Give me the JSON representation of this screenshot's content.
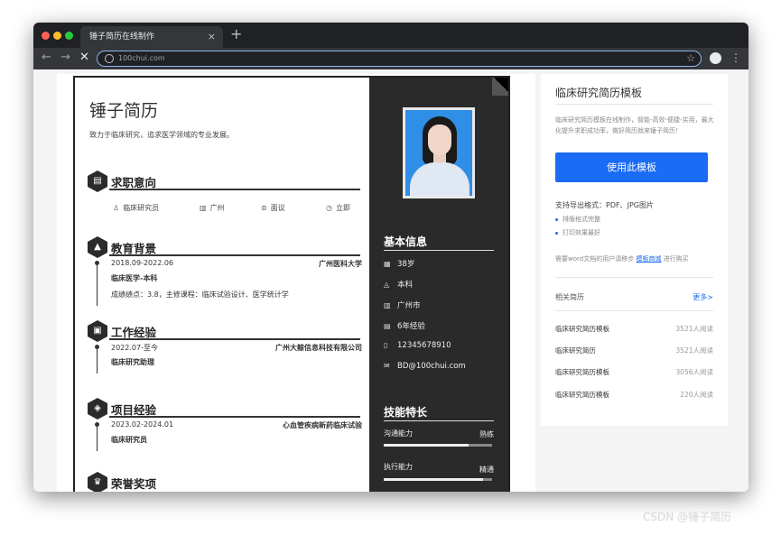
{
  "browser": {
    "tab_title": "锤子简历在线制作",
    "tab_close": "×",
    "new_tab": "+",
    "url": "100chui.com",
    "icons": [
      "back-arrow-icon",
      "forward-arrow-icon",
      "stop-loading-icon",
      "site-info-icon",
      "bookmark-star-icon",
      "profile-avatar-icon",
      "more-menu-icon"
    ]
  },
  "resume": {
    "name": "锤子简历",
    "motto": "致力于临床研究，追求医学领域的专业发展。",
    "sections": {
      "intent": "求职意向",
      "education": "教育背景",
      "work": "工作经验",
      "project": "项目经验",
      "honor": "荣誉奖项"
    },
    "intent": {
      "position": "临床研究员",
      "city": "广州",
      "salary": "面议",
      "availability": "立即"
    },
    "education": {
      "period": "2018.09-2022.06",
      "school": "广州医科大学",
      "major": "临床医学-本科",
      "detail": "成绩绩点：3.8，主修课程：临床试验设计、医学统计学"
    },
    "work": {
      "period": "2022.07-至今",
      "company": "广州大鲸信息科技有限公司",
      "role": "临床研究助理"
    },
    "project": {
      "period": "2023.02-2024.01",
      "name": "心血管疾病新药临床试验",
      "role": "临床研究员"
    },
    "sidebar": {
      "basic_title": "基本信息",
      "age": "38岁",
      "degree": "本科",
      "city": "广州市",
      "experience": "6年经验",
      "phone": "12345678910",
      "email": "BD@100chui.com",
      "skills_title": "技能特长",
      "skills": [
        {
          "name": "沟通能力",
          "level": "熟练",
          "fill": 0.78
        },
        {
          "name": "执行能力",
          "level": "精通",
          "fill": 0.92
        }
      ]
    }
  },
  "panel": {
    "title": "临床研究简历模板",
    "desc": "临床研究简历模板在线制作，智能-高效-便捷-实用，最大化提升求职成功率，做好简历就来锤子简历！",
    "use_button": "使用此模板",
    "formats": "支持导出格式：PDF、JPG图片",
    "features": [
      "排版格式完整",
      "打印效果最好"
    ],
    "note_prefix": "需要word文档的用户请移步",
    "note_link": "模板商城",
    "note_suffix": "进行购买",
    "related_title": "相关简历",
    "more": "更多>",
    "related": [
      {
        "title": "临床研究简历模板",
        "reads": "3521人阅读"
      },
      {
        "title": "临床研究简历",
        "reads": "3521人阅读"
      },
      {
        "title": "临床研究简历模板",
        "reads": "3056人阅读"
      },
      {
        "title": "临床研究简历模板",
        "reads": "220人阅读"
      }
    ]
  },
  "watermark": "CSDN @锤子简历",
  "colors": {
    "accent_blue": "#1a6cf5",
    "sidebar_dark": "#2a2a2a",
    "browser_dark": "#202124"
  }
}
